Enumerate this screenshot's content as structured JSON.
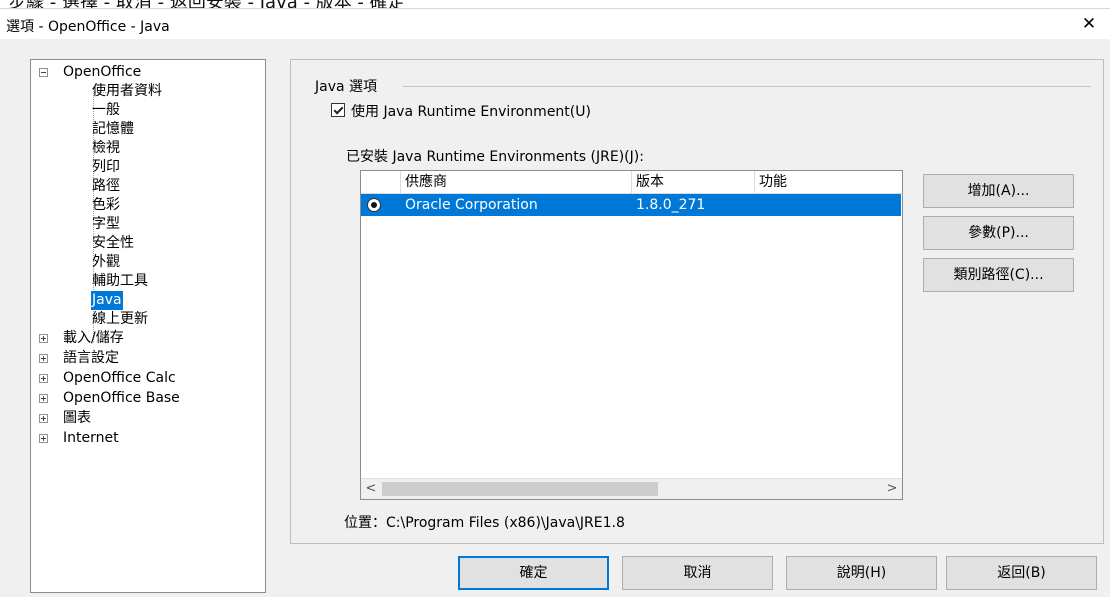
{
  "window": {
    "title": "選項 - OpenOffice - Java",
    "top_text": "步驟 - 選擇 - 取消 - 返回安裝 - Java - 版本 - 確定"
  },
  "tree": {
    "root": "OpenOffice",
    "children": [
      "使用者資料",
      "一般",
      "記憶體",
      "檢視",
      "列印",
      "路徑",
      "色彩",
      "字型",
      "安全性",
      "外觀",
      "輔助工具",
      "Java",
      "線上更新"
    ],
    "selected": "Java",
    "siblings": [
      "載入/儲存",
      "語言設定",
      "OpenOffice Calc",
      "OpenOffice Base",
      "圖表",
      "Internet"
    ]
  },
  "java": {
    "group_title": "Java 選項",
    "use_jre_label": "使用 Java Runtime Environment(U)",
    "use_jre_checked": true,
    "installed_label": "已安裝 Java Runtime Environments (JRE)(J):",
    "columns": [
      "供應商",
      "版本",
      "功能"
    ],
    "rows": [
      {
        "vendor": "Oracle Corporation",
        "version": "1.8.0_271",
        "features": ""
      }
    ],
    "location": "位置：C:\\Program Files (x86)\\Java\\JRE1.8"
  },
  "side_buttons": {
    "add": "增加(A)...",
    "params": "參數(P)...",
    "classpath": "類別路徑(C)..."
  },
  "bottom_buttons": {
    "ok": "確定",
    "cancel": "取消",
    "help": "說明(H)",
    "back": "返回(B)"
  },
  "colors": {
    "selection": "#0078d7",
    "default_button_border": "#0078d7"
  }
}
